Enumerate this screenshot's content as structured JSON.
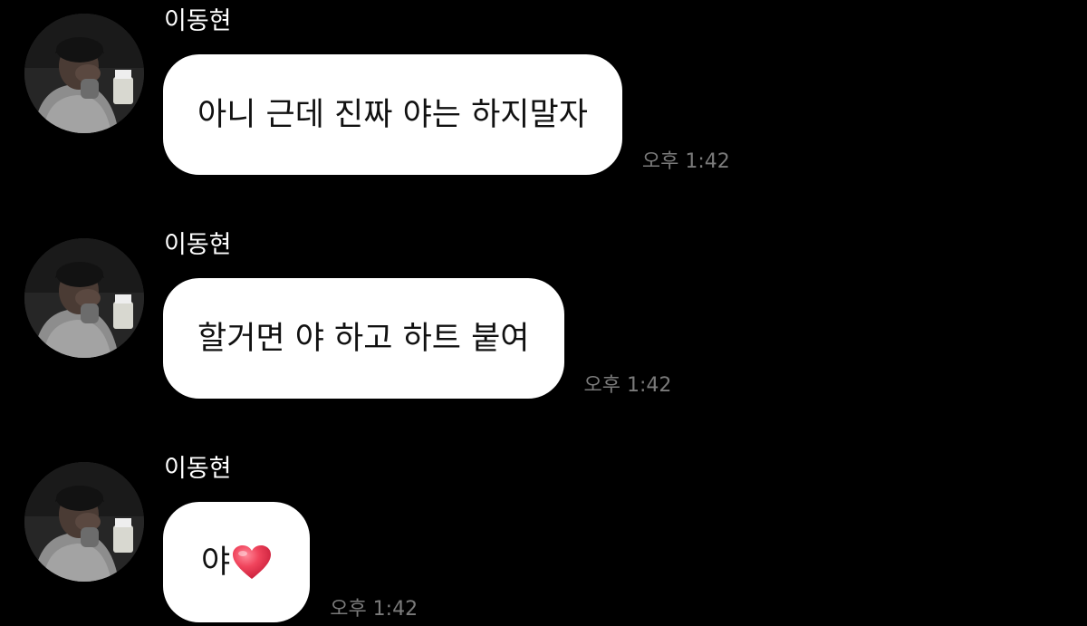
{
  "messages": [
    {
      "sender": "이동현",
      "text": "아니 근데 진짜 야는 하지말자",
      "time": "오후 1:42"
    },
    {
      "sender": "이동현",
      "text": "할거면 야 하고 하트 붙여",
      "time": "오후 1:42"
    },
    {
      "sender": "이동현",
      "text": "야",
      "emoji": "heart-emoji",
      "time": "오후 1:42"
    }
  ],
  "colors": {
    "background": "#000000",
    "bubble": "#ffffff",
    "bubble_text": "#111111",
    "sender_text": "#ffffff",
    "time_text": "#7a7a7a",
    "heart": "#e8344e"
  }
}
